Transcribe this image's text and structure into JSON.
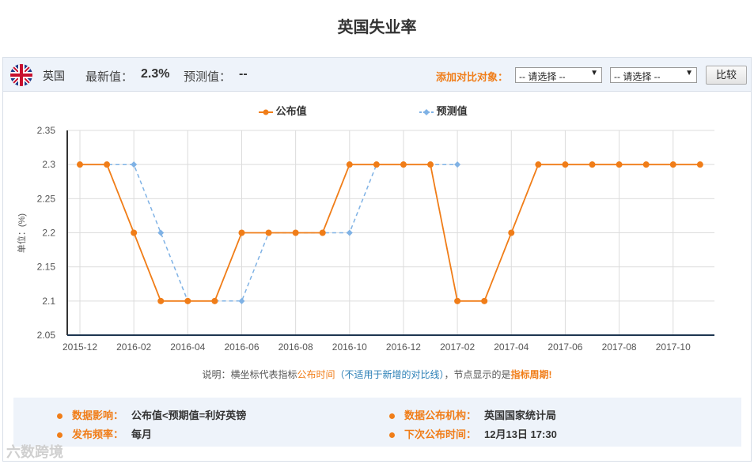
{
  "page": {
    "title": "英国失业率"
  },
  "header": {
    "country": "英国",
    "latest_label": "最新值：",
    "latest_value": "2.3%",
    "forecast_label": "预测值：",
    "forecast_value": "--",
    "compare_label": "添加对比对象：",
    "select1": "-- 请选择 --",
    "select2": "-- 请选择 --",
    "compare_button": "比较"
  },
  "note": {
    "p1": "说明：横坐标代表指标",
    "p2": "公布时间",
    "p3": "（不适用于新增的对比线）",
    "p4": "，节点显示的是",
    "p5": "指标周期!"
  },
  "info": {
    "impact_label": "数据影响：",
    "impact_value": "公布值<预期值=利好英镑",
    "agency_label": "数据公布机构：",
    "agency_value": "英国国家统计局",
    "frequency_label": "发布频率：",
    "frequency_value": "每月",
    "next_label": "下次公布时间：",
    "next_value": "12月13日 17:30"
  },
  "watermark": "六数跨境",
  "colors": {
    "actual": "#f07d18",
    "forecast": "#7fb2e5",
    "accent": "#f07d18"
  },
  "chart_data": {
    "type": "line",
    "ylabel": "单位：(%)",
    "ylim": [
      2.05,
      2.35
    ],
    "yticks": [
      "2.35",
      "2.3",
      "2.25",
      "2.2",
      "2.15",
      "2.1",
      "2.05"
    ],
    "x": [
      "2015-12",
      "2016-01",
      "2016-02",
      "2016-03",
      "2016-04",
      "2016-05",
      "2016-06",
      "2016-07",
      "2016-08",
      "2016-09",
      "2016-10",
      "2016-11",
      "2016-12",
      "2017-01",
      "2017-02",
      "2017-03",
      "2017-04",
      "2017-05",
      "2017-06",
      "2017-07",
      "2017-08",
      "2017-09",
      "2017-10",
      "2017-11"
    ],
    "xtick_labels": [
      "2015-12",
      "2016-02",
      "2016-04",
      "2016-06",
      "2016-08",
      "2016-10",
      "2016-12",
      "2017-02",
      "2017-04",
      "2017-06",
      "2017-08",
      "2017-10"
    ],
    "series": [
      {
        "name": "公布值",
        "color": "#f07d18",
        "dashed": false,
        "values": [
          2.3,
          2.3,
          2.2,
          2.1,
          2.1,
          2.1,
          2.2,
          2.2,
          2.2,
          2.2,
          2.3,
          2.3,
          2.3,
          2.3,
          2.1,
          2.1,
          2.2,
          2.3,
          2.3,
          2.3,
          2.3,
          2.3,
          2.3,
          2.3
        ]
      },
      {
        "name": "预测值",
        "color": "#7fb2e5",
        "dashed": true,
        "values": [
          2.3,
          2.3,
          2.3,
          2.2,
          2.1,
          2.1,
          2.1,
          2.2,
          2.2,
          2.2,
          2.2,
          2.3,
          2.3,
          2.3,
          2.3,
          null,
          null,
          null,
          null,
          null,
          null,
          null,
          null,
          null
        ]
      }
    ],
    "legend": "top-center",
    "grid": true
  }
}
